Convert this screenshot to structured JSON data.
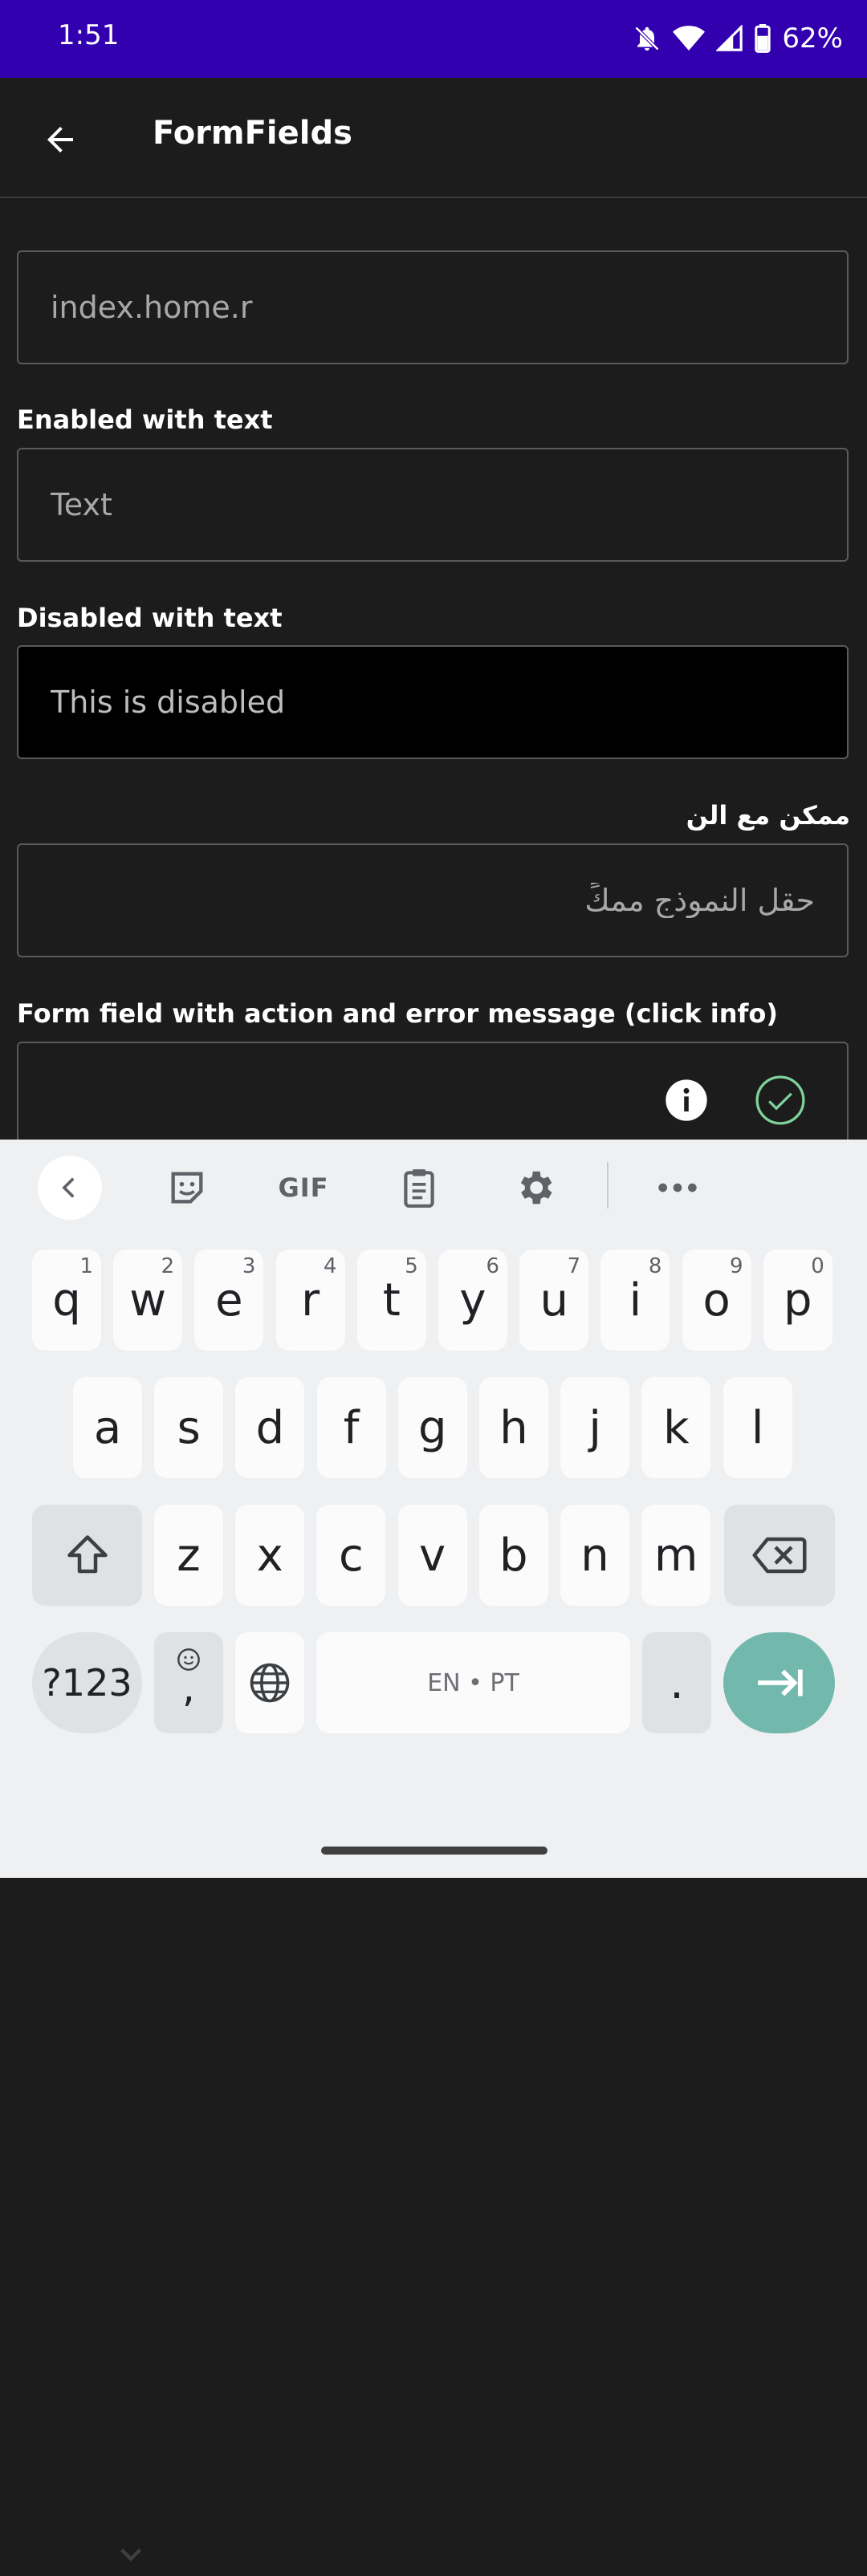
{
  "status_bar": {
    "time": "1:51",
    "battery": "62%",
    "icons": [
      "bell-off-icon",
      "wifi-icon",
      "signal-icon",
      "battery-icon"
    ],
    "background": "#3300b0"
  },
  "app_bar": {
    "title": "FormFields",
    "back_icon": "arrow-left-icon"
  },
  "form": {
    "field1": {
      "placeholder": "index.home.r"
    },
    "field2": {
      "label": "Enabled with text",
      "placeholder": "Text"
    },
    "field3": {
      "label": "Disabled with text",
      "value": "This is disabled"
    },
    "field4": {
      "label": "ممكن مع الن",
      "placeholder": "حقل النموذج ممكً"
    },
    "field5": {
      "label": "Form field with action and error message (click info)",
      "icons": [
        "info-icon",
        "check-circle-icon"
      ]
    }
  },
  "keyboard": {
    "toolbar": [
      "chevron-left-icon",
      "sticker-icon",
      "GIF",
      "clipboard-icon",
      "gear-icon",
      "more-icon"
    ],
    "gif_label": "GIF",
    "row1": [
      {
        "k": "q",
        "h": "1"
      },
      {
        "k": "w",
        "h": "2"
      },
      {
        "k": "e",
        "h": "3"
      },
      {
        "k": "r",
        "h": "4"
      },
      {
        "k": "t",
        "h": "5"
      },
      {
        "k": "y",
        "h": "6"
      },
      {
        "k": "u",
        "h": "7"
      },
      {
        "k": "i",
        "h": "8"
      },
      {
        "k": "o",
        "h": "9"
      },
      {
        "k": "p",
        "h": "0"
      }
    ],
    "row2": [
      "a",
      "s",
      "d",
      "f",
      "g",
      "h",
      "j",
      "k",
      "l"
    ],
    "row3": [
      "z",
      "x",
      "c",
      "v",
      "b",
      "n",
      "m"
    ],
    "symbols_label": "?123",
    "comma_label": ",",
    "space_label": "EN • PT",
    "period_label": ".",
    "accent": "#72b8ad"
  }
}
